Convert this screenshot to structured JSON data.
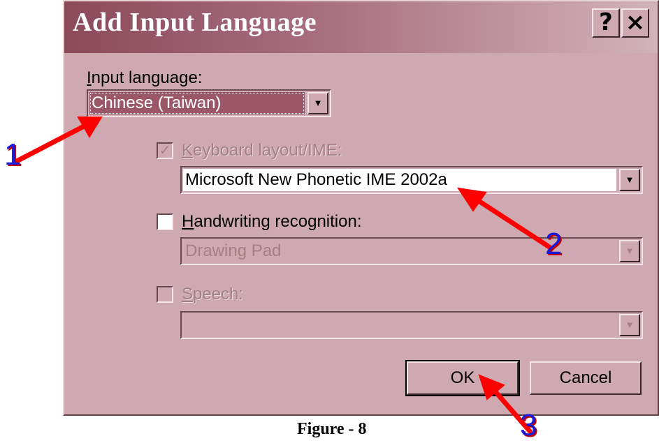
{
  "dialog": {
    "title": "Add Input Language",
    "help_label": "?",
    "close_label": "×",
    "input_language": {
      "label": "Input language:",
      "value": "Chinese (Taiwan)"
    },
    "keyboard": {
      "label": "Keyboard layout/IME:",
      "checked": "✓",
      "value": "Microsoft New Phonetic IME 2002a"
    },
    "handwriting": {
      "label": "Handwriting recognition:",
      "value": "Drawing Pad"
    },
    "speech": {
      "label": "Speech:",
      "value": ""
    },
    "ok_label": "OK",
    "cancel_label": "Cancel",
    "dropdown_glyph": "▼"
  },
  "annotations": {
    "n1": "1",
    "n2": "2",
    "n3": "3",
    "arrow_color": "#ff0000"
  },
  "caption": "Figure - 8",
  "colors": {
    "dialog_bg": "#cfa9b1",
    "title_start": "#8b4a5a",
    "selection": "#9b5767"
  }
}
